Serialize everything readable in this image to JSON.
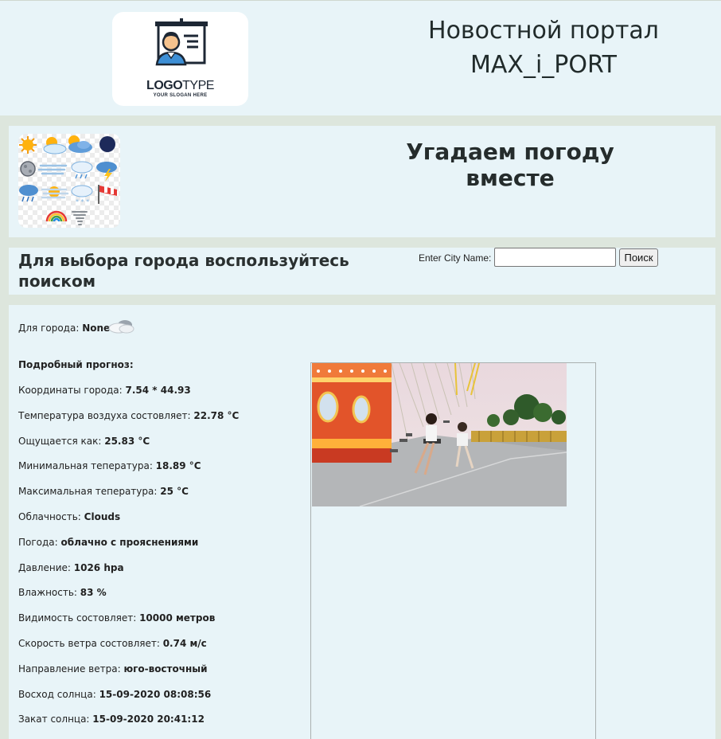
{
  "header": {
    "logo": {
      "word_bold": "LOGO",
      "word_light": "TYPE",
      "slogan": "YOUR SLOGAN HERE"
    },
    "title_line1": "Новостной портал",
    "title_line2": "MAX_i_PORT"
  },
  "weather_banner": {
    "heading": "Угадаем погоду вместе",
    "icons": [
      "sun-icon",
      "sun-cloud-icon",
      "sun-cloud-icon",
      "moon-icon",
      "full-moon-icon",
      "fog-icon",
      "rain-cloud-icon",
      "thunderstorm-icon",
      "rain-icon",
      "fog-sun-icon",
      "snow-cloud-icon",
      "windsock-icon",
      "rainbow-icon",
      "tornado-icon"
    ]
  },
  "search": {
    "heading": "Для выбора города воспользуйтесь поиском",
    "label": "Enter City Name:",
    "input_value": "",
    "button_label": "Поиск"
  },
  "result": {
    "city_label": "Для города: ",
    "city_value": "None",
    "forecast_title": "Подробный прогноз:",
    "rows": [
      {
        "label": "Координаты города: ",
        "value": "7.54 * 44.93"
      },
      {
        "label": "Температура воздуха состовляет: ",
        "value": "22.78 °C"
      },
      {
        "label": "Ощущается как: ",
        "value": "25.83 °C"
      },
      {
        "label": "Минимальная тепература: ",
        "value": "18.89 °C"
      },
      {
        "label": "Максимальная тепература: ",
        "value": "25 °C"
      },
      {
        "label": "Облачность: ",
        "value": "Clouds"
      },
      {
        "label": "Погода: ",
        "value": "облачно с прояснениями"
      },
      {
        "label": "Давление: ",
        "value": "1026 hpa"
      },
      {
        "label": "Влажность: ",
        "value": "83 %"
      },
      {
        "label": "Видимость состовляет: ",
        "value": "10000 метров"
      },
      {
        "label": "Скорость ветра состовляет: ",
        "value": "0.74 м/с"
      },
      {
        "label": "Направление ветра: ",
        "value": "юго-восточный"
      },
      {
        "label": "Восход солнца: ",
        "value": "15-09-2020 08:08:56"
      },
      {
        "label": "Закат солнца: ",
        "value": "15-09-2020 20:41:12"
      }
    ]
  }
}
